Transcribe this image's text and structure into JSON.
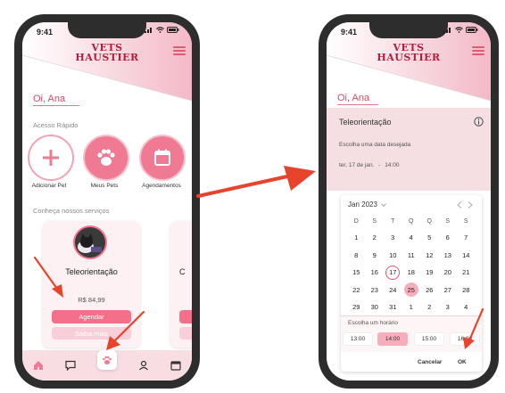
{
  "status": {
    "time": "9:41"
  },
  "brand": {
    "line1": "VETS",
    "line2": "HAUSTIER"
  },
  "home": {
    "greeting": "Oi, Ana",
    "quick_access_title": "Acesso Rápido",
    "quick_items": [
      {
        "label": "Adicionar Pet",
        "icon": "plus-icon"
      },
      {
        "label": "Meus Pets",
        "icon": "paw-icon"
      },
      {
        "label": "Agendamentos",
        "icon": "calendar-icon"
      }
    ],
    "services_title": "Conheça nossos serviços",
    "service_card": {
      "title": "Teleorientação",
      "price": "R$ 84,99",
      "primary_button": "Agendar",
      "secondary_button": "Saiba mais"
    },
    "peek_card_letter": "C",
    "nav_icons": [
      "home-icon",
      "chat-icon",
      "paw-icon",
      "user-icon",
      "calendar-icon"
    ]
  },
  "booking": {
    "greeting": "Oi, Ana",
    "title": "Teleorientação",
    "prompt": "Escolha uma data desejada",
    "selected_date": "ter, 17 de jan.",
    "selected_time": "14:00",
    "separator": "-",
    "calendar": {
      "month_label": "Jan 2023",
      "weekdays": [
        "D",
        "S",
        "T",
        "Q",
        "Q",
        "S",
        "S"
      ],
      "days": [
        "1",
        "2",
        "3",
        "4",
        "5",
        "6",
        "7",
        "8",
        "9",
        "10",
        "11",
        "12",
        "13",
        "14",
        "15",
        "16",
        "17",
        "18",
        "19",
        "20",
        "21",
        "22",
        "23",
        "24",
        "25",
        "26",
        "27",
        "28",
        "29",
        "30",
        "31",
        "1",
        "2",
        "3",
        "4"
      ],
      "outlined_day": "17",
      "highlighted_day": "25"
    },
    "time_label": "Escolha um horário",
    "times": [
      "13:00",
      "14:00",
      "15:00",
      "16:00"
    ],
    "selected_time_index": 1,
    "cancel_label": "Cancelar",
    "ok_label": "OK"
  },
  "colors": {
    "accent": "#f4708a",
    "brand": "#b21e3c",
    "arrow": "#e8432b"
  }
}
